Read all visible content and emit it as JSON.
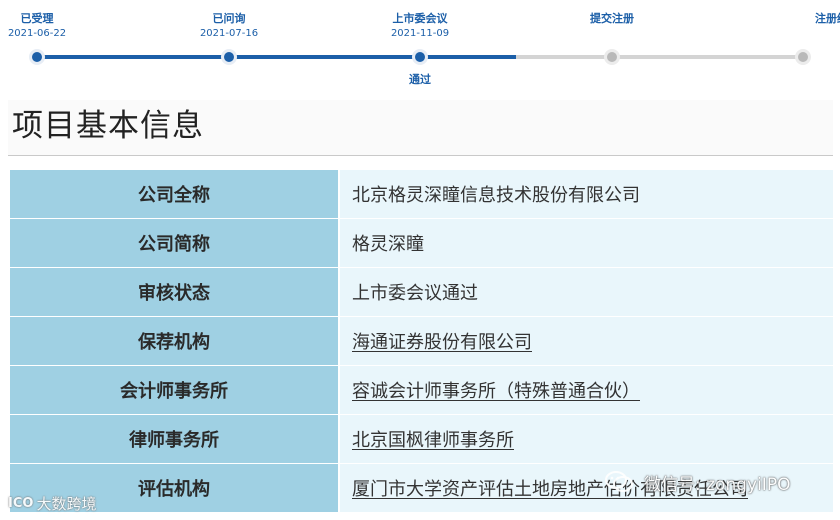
{
  "timeline": {
    "steps": [
      {
        "label": "已受理",
        "date": "2021-06-22",
        "status": "done",
        "sub": ""
      },
      {
        "label": "已问询",
        "date": "2021-07-16",
        "status": "done",
        "sub": ""
      },
      {
        "label": "上市委会议",
        "date": "2021-11-09",
        "status": "done",
        "sub": "通过"
      },
      {
        "label": "提交注册",
        "date": "",
        "status": "pending",
        "sub": ""
      },
      {
        "label": "注册结果",
        "date": "",
        "status": "pending",
        "sub": ""
      }
    ],
    "colors": {
      "done": "#1c5fa8",
      "pending": "#b9b9b9"
    }
  },
  "section": {
    "title": "项目基本信息"
  },
  "info": {
    "rows": [
      {
        "label": "公司全称",
        "value": "北京格灵深瞳信息技术股份有限公司",
        "link": false
      },
      {
        "label": "公司简称",
        "value": "格灵深瞳",
        "link": false
      },
      {
        "label": "审核状态",
        "value": "上市委会议通过",
        "link": false
      },
      {
        "label": "保荐机构",
        "value": "海通证券股份有限公司",
        "link": true
      },
      {
        "label": "会计师事务所",
        "value": "容诚会计师事务所（特殊普通合伙）",
        "link": true
      },
      {
        "label": "律师事务所",
        "value": "北京国枫律师事务所",
        "link": true
      },
      {
        "label": "评估机构",
        "value": "厦门市大学资产评估土地房地产估价有限责任公司",
        "link": true
      }
    ],
    "colors": {
      "label_bg": "#9fd0e3",
      "value_bg": "#e9f6fb"
    }
  },
  "watermarks": {
    "left_mark": "ICO",
    "left_text": "大数跨境",
    "right_text": "微信号: zongyiIPO"
  }
}
